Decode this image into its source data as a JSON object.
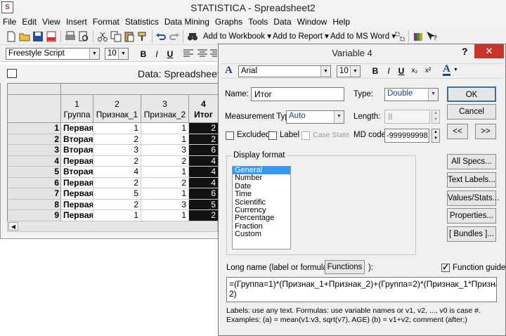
{
  "app": {
    "title": "STATISTICA - Spreadsheet2",
    "icon_letter": "S"
  },
  "menu": [
    "File",
    "Edit",
    "View",
    "Insert",
    "Format",
    "Statistics",
    "Data Mining",
    "Graphs",
    "Tools",
    "Data",
    "Window",
    "Help"
  ],
  "toolbar": {
    "add_to_workbook": "Add to Workbook ▾",
    "add_to_report": "Add to Report ▾",
    "add_to_ms_word": "Add to MS Word ▾"
  },
  "format_toolbar": {
    "font": "Freestyle Script",
    "size": "10",
    "bold": "B",
    "italic": "I",
    "underline": "U"
  },
  "spreadsheet": {
    "title": "Data: Spreadsheet2",
    "columns": [
      {
        "num": "1",
        "name": "Группа"
      },
      {
        "num": "2",
        "name": "Признак_1"
      },
      {
        "num": "3",
        "name": "Признак_2"
      },
      {
        "num": "4",
        "name": "Итог"
      }
    ],
    "rows": [
      {
        "n": "1",
        "group": "Первая",
        "p1": "1",
        "p2": "1",
        "total": "2"
      },
      {
        "n": "2",
        "group": "Вторая",
        "p1": "2",
        "p2": "1",
        "total": "2"
      },
      {
        "n": "3",
        "group": "Вторая",
        "p1": "3",
        "p2": "3",
        "total": "6"
      },
      {
        "n": "4",
        "group": "Первая",
        "p1": "2",
        "p2": "2",
        "total": "4"
      },
      {
        "n": "5",
        "group": "Вторая",
        "p1": "4",
        "p2": "1",
        "total": "4"
      },
      {
        "n": "6",
        "group": "Первая",
        "p1": "2",
        "p2": "2",
        "total": "4"
      },
      {
        "n": "7",
        "group": "Первая",
        "p1": "5",
        "p2": "1",
        "total": "6"
      },
      {
        "n": "8",
        "group": "Первая",
        "p1": "2",
        "p2": "3",
        "total": "5"
      },
      {
        "n": "9",
        "group": "Первая",
        "p1": "1",
        "p2": "1",
        "total": "2"
      }
    ]
  },
  "dialog": {
    "title": "Variable 4",
    "help": "?",
    "close": "✕",
    "font": "Arial",
    "size": "10",
    "bold": "B",
    "italic": "I",
    "underline": "U",
    "subscript": "x₂",
    "superscript": "x²",
    "name_label": "Name:",
    "name_value": "Итог",
    "type_label": "Type:",
    "type_value": "Double",
    "ok": "OK",
    "cancel": "Cancel",
    "measurement_label": "Measurement Type:",
    "measurement_value": "Auto",
    "length_label": "Length:",
    "length_value": "8",
    "prev": "<<",
    "next": ">>",
    "excluded": "Excluded",
    "label": "Label",
    "case_state": "Case State",
    "md_code_label": "MD code:",
    "md_code_value": "-999999998",
    "display_format_label": "Display format",
    "formats": [
      "General",
      "Number",
      "Date",
      "Time",
      "Scientific",
      "Currency",
      "Percentage",
      "Fraction",
      "Custom"
    ],
    "selected_format": "General",
    "all_specs": "All Specs...",
    "text_labels": "Text Labels...",
    "values_stats": "Values/Stats...",
    "properties": "Properties...",
    "bundles": "[ Bundles ]...",
    "long_name_label": "Long name (label or formula with",
    "functions_button": "Functions",
    "long_name_close": "):",
    "function_guide": "Function guide",
    "formula_line1": "=(Группа=1)*(Признак_1+Признак_2)+(Группа=2)*(Признак_1*Признак_",
    "formula_line2": "2)",
    "hint_line1": "Labels: use any text.  Formulas: use variable names or v1, v2, ..., v0 is case #.",
    "hint_line2": "Examples:   (a) = mean(v1:v3, sqrt(v7), AGE)   (b) = v1+v2; comment (after;)"
  },
  "colors": {
    "accent_blue": "#3399ff",
    "close_red": "#c8352b",
    "selected_column": "#111111"
  }
}
